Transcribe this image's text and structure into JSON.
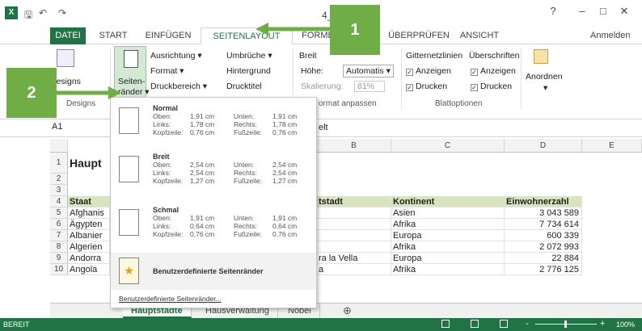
{
  "window": {
    "title": "4_A",
    "help": "?",
    "minimize": "–",
    "maximize": "□",
    "close": "✕",
    "account": "Anmelden"
  },
  "qat": {
    "save": "🖫",
    "undo": "↶",
    "redo": "↷"
  },
  "tabs": [
    "DATEI",
    "START",
    "EINFÜGEN",
    "SEITENLAYOUT",
    "FORMELN",
    "ÜBERPRÜFEN",
    "ANSICHT"
  ],
  "ribbon": {
    "designs": "Designs",
    "designs_group": "Designs",
    "seitenraender_1": "Seiten-",
    "seitenraender_2": "ränder ▾",
    "ausrichtung": "Ausrichtung ▾",
    "format": "Format ▾",
    "druckbereich": "Druckbereich ▾",
    "umbrueche": "Umbrüche ▾",
    "hintergrund": "Hintergrund",
    "drucktitel": "Drucktitel",
    "breite": "Breit",
    "hoehe": "Höhe:",
    "hoehe_val": "Automatis ▾",
    "skalierung": "Skalierung:",
    "skalierung_val": "81%",
    "format_anpassen": "ormat anpassen",
    "gitternetzlinien": "Gitternetzlinien",
    "ueberschriften": "Überschriften",
    "anzeigen1": "Anzeigen",
    "anzeigen2": "Anzeigen",
    "drucken1": "Drucken",
    "drucken2": "Drucken",
    "blattoptionen": "Blattoptionen",
    "anordnen": "Anordnen",
    "anordnen_arrow": "▾"
  },
  "formula": {
    "namebox": "A1",
    "content": "elt"
  },
  "columns": [
    "B",
    "C",
    "D",
    "E"
  ],
  "rows": [
    "1",
    "2",
    "3",
    "4",
    "5",
    "6",
    "7",
    "8",
    "9",
    "10"
  ],
  "sheet": {
    "title": "Haupt",
    "headers": [
      "Staat",
      "tstadt",
      "Kontinent",
      "Einwohnerzahl"
    ],
    "data": [
      [
        "Afghanis",
        "",
        "Asien",
        "3 043 589"
      ],
      [
        "Ägypten",
        "",
        "Afrika",
        "7 734 614"
      ],
      [
        "Albanier",
        "",
        "Europa",
        "600 339"
      ],
      [
        "Algerien",
        "",
        "Afrika",
        "2 072 993"
      ],
      [
        "Andorra",
        "ra la Vella",
        "Europa",
        "22 884"
      ],
      [
        "Angola",
        "a",
        "Afrika",
        "2 776 125"
      ]
    ]
  },
  "sheettabs": [
    "Hauptstädte",
    "Hausverwaltung",
    "Nobel"
  ],
  "add_sheet": "⊕",
  "status": {
    "left": "BEREIT",
    "zoom": "100%",
    "zoom_minus": "-",
    "zoom_plus": "+"
  },
  "menu": {
    "items": [
      {
        "name": "Normal",
        "l1": [
          "Oben:",
          "1,91 cm",
          "Unten:",
          "1,91 cm"
        ],
        "l2": [
          "Links:",
          "1,78 cm",
          "Rechts:",
          "1,78 cm"
        ],
        "l3": [
          "Kopfzeile:",
          "0,76 cm",
          "Fußzeile:",
          "0,76 cm"
        ]
      },
      {
        "name": "Breit",
        "l1": [
          "Oben:",
          "2,54 cm",
          "Unten:",
          "2,54 cm"
        ],
        "l2": [
          "Links:",
          "2,54 cm",
          "Rechts:",
          "2,54 cm"
        ],
        "l3": [
          "Kopfzeile:",
          "1,27 cm",
          "Fußzeile:",
          "1,27 cm"
        ]
      },
      {
        "name": "Schmal",
        "l1": [
          "Oben:",
          "1,91 cm",
          "Unten:",
          "1,91 cm"
        ],
        "l2": [
          "Links:",
          "0,64 cm",
          "Rechts:",
          "0,64 cm"
        ],
        "l3": [
          "Kopfzeile:",
          "0,76 cm",
          "Fußzeile:",
          "0,76 cm"
        ]
      }
    ],
    "custom_item": "Benutzerdefinierte Seitenränder",
    "custom_link": "Benutzerdefinierte Seitenränder..."
  },
  "callouts": {
    "c1": "1",
    "c2": "2"
  },
  "colors": {
    "accent": "#217346",
    "callout": "#70ad47",
    "header_fill": "#d8e4bc"
  }
}
